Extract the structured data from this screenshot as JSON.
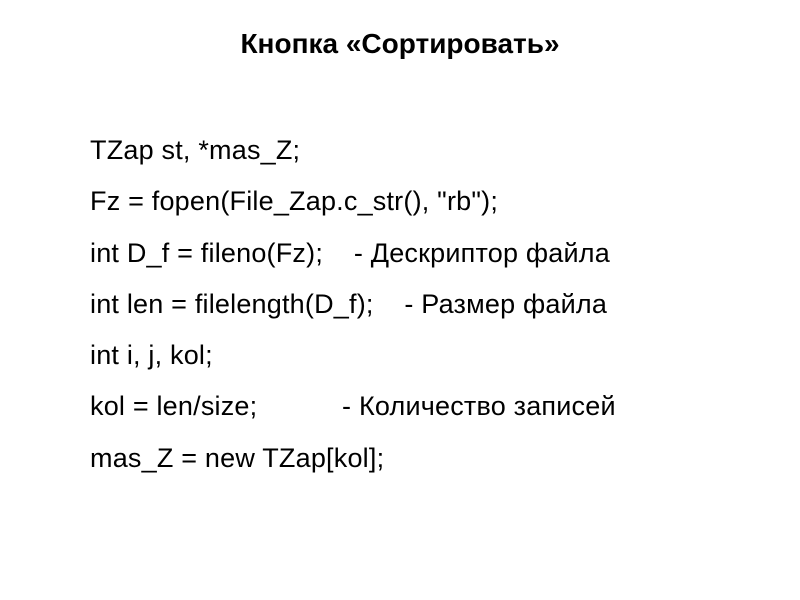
{
  "title": "Кнопка «Сортировать»",
  "lines": [
    "TZap st, *mas_Z;",
    "Fz = fopen(File_Zap.c_str(), \"rb\");",
    "int D_f = fileno(Fz);    - Дескриптор файла",
    "int len = filelength(D_f);    - Размер файла",
    "int i, j, kol;",
    "kol = len/size;           - Количество записей",
    "mas_Z = new TZap[kol];"
  ]
}
